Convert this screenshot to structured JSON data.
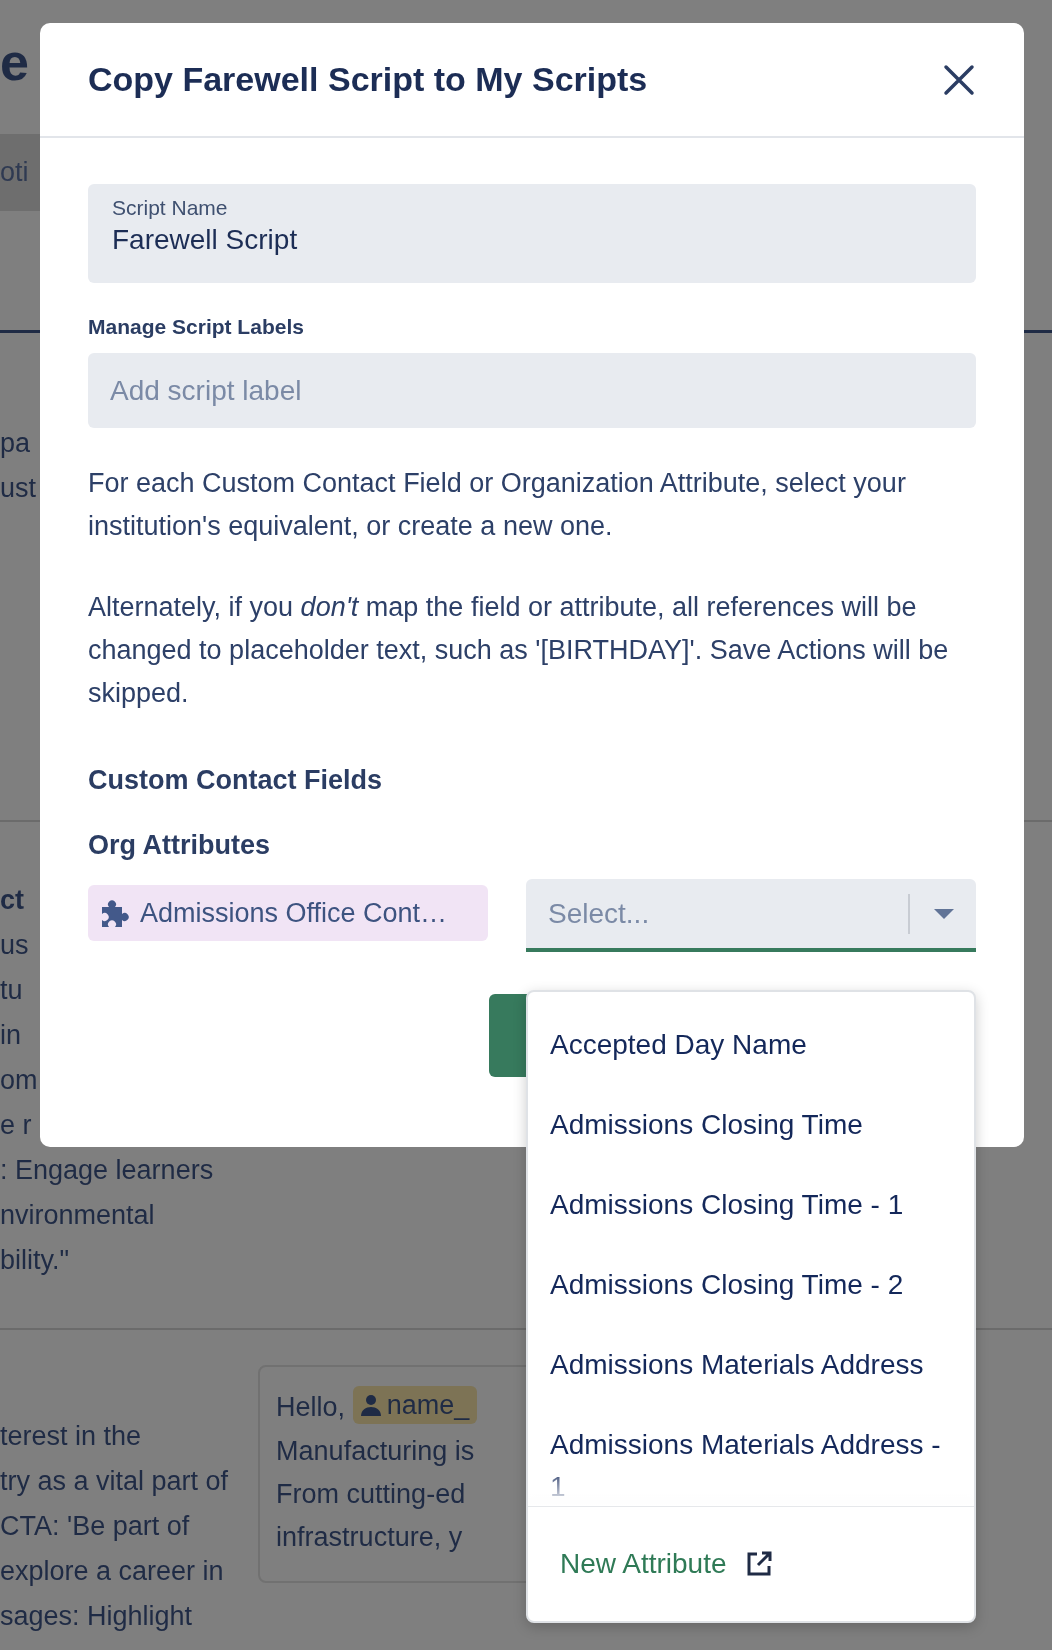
{
  "background": {
    "title_fragment": "e",
    "tab_fragment": "oti",
    "sections": [
      {
        "left_lines": [
          "pa",
          "ust"
        ]
      },
      {
        "heading_fragment": "ct",
        "left_lines": [
          "us",
          "tu",
          " in",
          "om",
          "e r",
          ": Engage learners",
          "nvironmental",
          "bility.\""
        ]
      },
      {
        "left_lines": [
          "terest in the",
          "try as a vital part of",
          " CTA: 'Be part of",
          "explore a career in",
          "sages: Highlight"
        ],
        "preview": {
          "greeting": "Hello,",
          "chip": "name_",
          "lines": [
            "Manufacturing is",
            "From cutting-ed",
            "infrastructure, y"
          ]
        }
      }
    ]
  },
  "dialog": {
    "title": "Copy Farewell Script to My Scripts",
    "script_name": {
      "label": "Script Name",
      "value": "Farewell Script"
    },
    "labels_field": {
      "label": "Manage Script Labels",
      "placeholder": "Add script label"
    },
    "paragraphs": [
      "For each Custom Contact Field or Organization Attribute, select your institution's equivalent, or create a new one.",
      "Alternately, if you *don't* map the field or attribute, all references will be changed to placeholder text, such as '[BIRTHDAY]'. Save Actions will be skipped."
    ],
    "custom_fields_heading": "Custom Contact Fields",
    "org_heading": "Org Attributes",
    "mappings": [
      {
        "attribute": "Admissions Office Cont…",
        "select_placeholder": "Select...",
        "expanded": true
      }
    ],
    "menu": {
      "options": [
        "Accepted Day Name",
        "Admissions Closing Time",
        "Admissions Closing Time - 1",
        "Admissions Closing Time - 2",
        "Admissions Materials Address",
        "Admissions Materials Address - 1"
      ],
      "footer_link": "New Attribute"
    }
  }
}
